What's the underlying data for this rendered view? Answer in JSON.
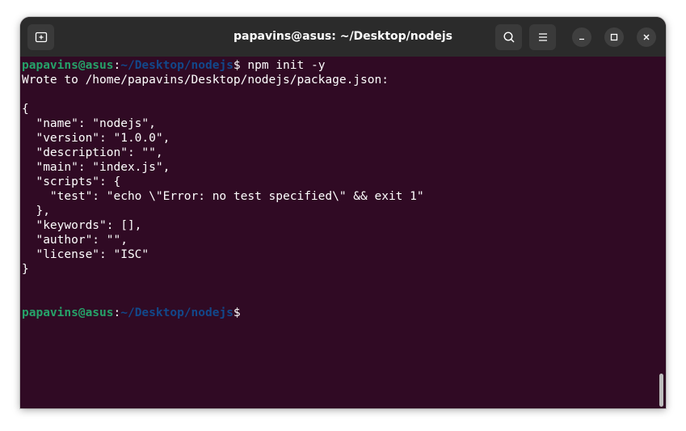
{
  "window": {
    "title": "papavins@asus: ~/Desktop/nodejs"
  },
  "titlebar": {
    "new_tab_icon": "new-tab-icon",
    "search_icon": "search-icon",
    "menu_icon": "hamburger-menu-icon",
    "minimize_icon": "minimize-icon",
    "maximize_icon": "maximize-icon",
    "close_icon": "close-icon"
  },
  "terminal": {
    "prompt1": {
      "user_host": "papavins@asus",
      "colon": ":",
      "path": "~/Desktop/nodejs",
      "dollar": "$ ",
      "command": "npm init -y"
    },
    "output": [
      "Wrote to /home/papavins/Desktop/nodejs/package.json:",
      "",
      "{",
      "  \"name\": \"nodejs\",",
      "  \"version\": \"1.0.0\",",
      "  \"description\": \"\",",
      "  \"main\": \"index.js\",",
      "  \"scripts\": {",
      "    \"test\": \"echo \\\"Error: no test specified\\\" && exit 1\"",
      "  },",
      "  \"keywords\": [],",
      "  \"author\": \"\",",
      "  \"license\": \"ISC\"",
      "}",
      "",
      ""
    ],
    "prompt2": {
      "user_host": "papavins@asus",
      "colon": ":",
      "path": "~/Desktop/nodejs",
      "dollar": "$"
    }
  },
  "colors": {
    "terminal_bg": "#300a24",
    "titlebar_bg": "#2b2b2b",
    "prompt_user": "#26a269",
    "prompt_path": "#12488b",
    "text": "#ffffff"
  }
}
